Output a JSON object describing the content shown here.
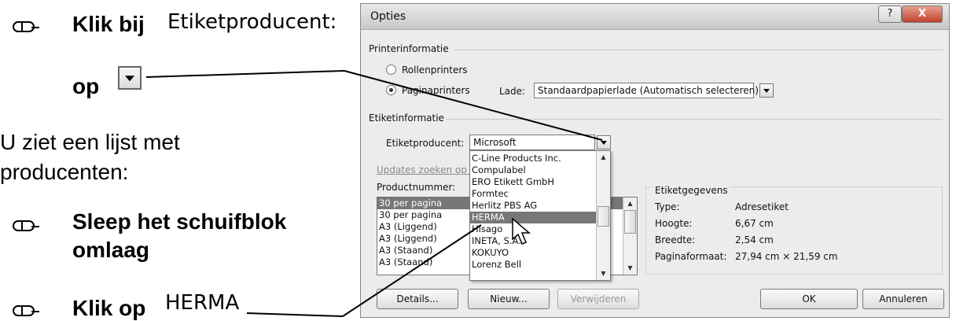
{
  "instructions": {
    "step1_text": "Klik bij",
    "step1_field": "Etiketproducent:",
    "step1_op": "op",
    "info_line1": "U ziet een lijst met",
    "info_line2": "producenten:",
    "step2_line1": "Sleep het schuifblok",
    "step2_line2": "omlaag",
    "step3_text": "Klik op",
    "step3_item": "HERMA"
  },
  "dialog": {
    "title": "Opties",
    "help_button": "?",
    "close_button": "X",
    "printer_group": "Printerinformatie",
    "radio_roll": "Rollenprinters",
    "radio_page": "Paginaprinters",
    "tray_label": "Lade:",
    "tray_value": "Standaardpapierlade (Automatisch selecteren)",
    "label_group": "Etiketinformatie",
    "vendor_label": "Etiketproducent:",
    "vendor_value": "Microsoft",
    "updates_link": "Updates zoeken op O",
    "product_label": "Productnummer:",
    "vendor_options": [
      "C-Line Products Inc.",
      "Compulabel",
      "ERO Etikett GmbH",
      "Formtec",
      "Herlitz PBS AG",
      "HERMA",
      "Hisago",
      "INETA, S.A.",
      "KOKUYO",
      "Lorenz Bell"
    ],
    "product_items": [
      "30 per pagina",
      "30 per pagina",
      "A3 (Liggend)",
      "A3 (Liggend)",
      "A3 (Staand)",
      "A3 (Staand)"
    ],
    "details_group": "Etiketgegevens",
    "details": [
      {
        "key": "Type:",
        "value": "Adresetiket"
      },
      {
        "key": "Hoogte:",
        "value": "6,67 cm"
      },
      {
        "key": "Breedte:",
        "value": "2,54 cm"
      },
      {
        "key": "Paginaformaat:",
        "value": "27,94 cm × 21,59 cm"
      }
    ],
    "buttons": {
      "details": "Details...",
      "new": "Nieuw...",
      "delete": "Verwijderen",
      "ok": "OK",
      "cancel": "Annuleren"
    }
  },
  "colors": {
    "highlight": "#777777",
    "dialog_bg": "#ececec"
  }
}
